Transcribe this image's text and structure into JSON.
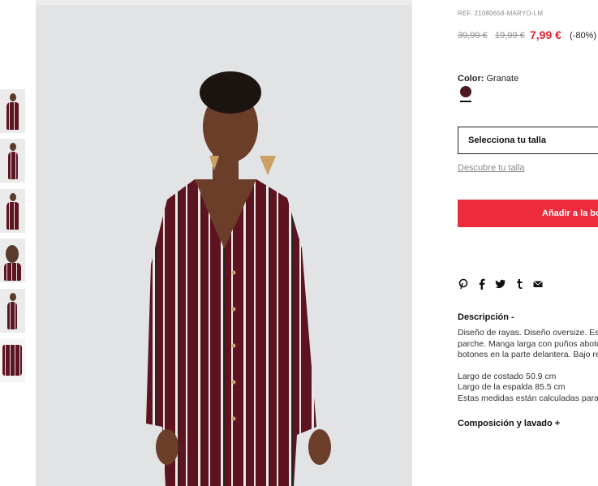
{
  "product": {
    "ref": "REF. 21080658-MARYO-LM",
    "price_original": "39,99 €",
    "price_previous": "19,99 €",
    "price_current": "7,99 €",
    "discount": "(-80%)"
  },
  "color": {
    "label": "Color:",
    "value": "Granate"
  },
  "size": {
    "select_label": "Selecciona tu talla",
    "discover_link": "Descubre tu talla"
  },
  "cart": {
    "add_label": "Añadir a la bo"
  },
  "share": {
    "icons": [
      "pinterest-icon",
      "facebook-icon",
      "twitter-icon",
      "tumblr-icon",
      "email-icon"
    ]
  },
  "description": {
    "title": "Descripción -",
    "lines": [
      "Diseño de rayas. Diseño oversize. Esc",
      "parche. Manga larga con puños aboto",
      "botones en la parte delantera. Bajo re"
    ],
    "measures": [
      "Largo de costado 50.9 cm",
      "Largo de la espalda 85.5 cm",
      "Estas medidas están calculadas para"
    ]
  },
  "composition": {
    "title": "Composición y lavado +"
  },
  "colors": {
    "accent_red": "#ee2b3c",
    "price_red": "#e0202e",
    "garment": "#5e1420"
  }
}
